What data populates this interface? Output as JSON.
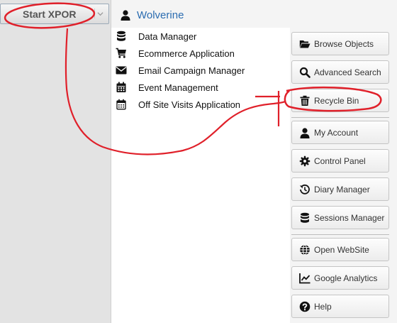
{
  "start_menu": {
    "start_label": "Start XPOR",
    "chevron_icon": "chevron-down-icon"
  },
  "user": {
    "name": "Wolverine",
    "icon": "user-icon"
  },
  "apps": [
    {
      "label": "Data Manager",
      "icon": "database-icon"
    },
    {
      "label": "Ecommerce Application",
      "icon": "shopping-cart-icon"
    },
    {
      "label": "Email Campaign Manager",
      "icon": "envelope-icon"
    },
    {
      "label": "Event Management",
      "icon": "calendar-icon"
    },
    {
      "label": "Off Site Visits Application",
      "icon": "calendar-outline-icon"
    }
  ],
  "side_buttons": [
    {
      "label": "Browse Objects",
      "icon": "folder-open-icon"
    },
    {
      "label": "Advanced Search",
      "icon": "search-icon"
    },
    {
      "label": "Recycle Bin",
      "icon": "trash-icon"
    },
    {
      "label": "My Account",
      "icon": "user-icon"
    },
    {
      "label": "Control Panel",
      "icon": "gear-icon"
    },
    {
      "label": "Diary Manager",
      "icon": "history-icon"
    },
    {
      "label": "Sessions Manager",
      "icon": "database-icon"
    },
    {
      "label": "Open WebSite",
      "icon": "globe-icon"
    },
    {
      "label": "Google Analytics",
      "icon": "line-chart-icon"
    },
    {
      "label": "Help",
      "icon": "question-circle-icon"
    }
  ],
  "annotation": {
    "color": "#e0202a"
  }
}
